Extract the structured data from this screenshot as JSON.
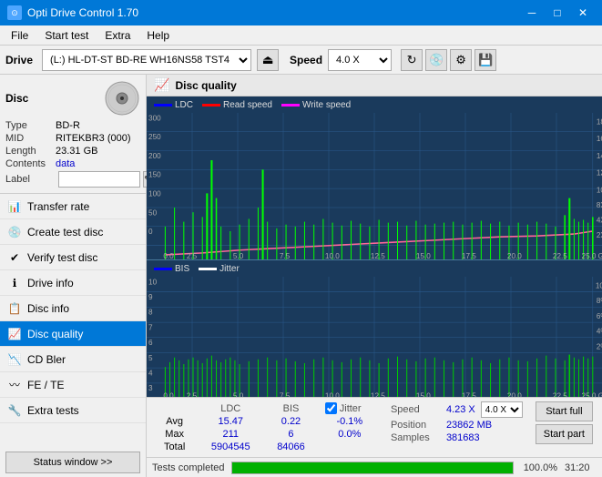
{
  "titleBar": {
    "title": "Opti Drive Control 1.70",
    "minBtn": "─",
    "maxBtn": "□",
    "closeBtn": "✕"
  },
  "menuBar": {
    "items": [
      "File",
      "Start test",
      "Extra",
      "Help"
    ]
  },
  "driveBar": {
    "driveLabel": "Drive",
    "driveValue": "(L:)  HL-DT-ST BD-RE  WH16NS58 TST4",
    "speedLabel": "Speed",
    "speedValue": "4.0 X"
  },
  "disc": {
    "title": "Disc",
    "typeLabel": "Type",
    "typeValue": "BD-R",
    "midLabel": "MID",
    "midValue": "RITEKBR3 (000)",
    "lengthLabel": "Length",
    "lengthValue": "23.31 GB",
    "contentsLabel": "Contents",
    "contentsValue": "data",
    "labelLabel": "Label",
    "labelValue": ""
  },
  "navItems": [
    {
      "id": "transfer-rate",
      "label": "Transfer rate",
      "icon": "📊"
    },
    {
      "id": "create-test-disc",
      "label": "Create test disc",
      "icon": "💿"
    },
    {
      "id": "verify-test-disc",
      "label": "Verify test disc",
      "icon": "✔"
    },
    {
      "id": "drive-info",
      "label": "Drive info",
      "icon": "ℹ"
    },
    {
      "id": "disc-info",
      "label": "Disc info",
      "icon": "📋"
    },
    {
      "id": "disc-quality",
      "label": "Disc quality",
      "icon": "📈",
      "active": true
    },
    {
      "id": "cd-bler",
      "label": "CD Bler",
      "icon": "📉"
    },
    {
      "id": "fe-te",
      "label": "FE / TE",
      "icon": "〰"
    },
    {
      "id": "extra-tests",
      "label": "Extra tests",
      "icon": "🔧"
    }
  ],
  "statusBtn": "Status window >>",
  "panel": {
    "title": "Disc quality",
    "legend1": {
      "color": "#0000ff",
      "label": "LDC"
    },
    "legend2": {
      "color": "#ff0000",
      "label": "Read speed"
    },
    "legend3": {
      "color": "#ff00ff",
      "label": "Write speed"
    },
    "legend4": {
      "color": "#0000ff",
      "label": "BIS"
    },
    "legend5": {
      "color": "#00ff00",
      "label": "Jitter"
    }
  },
  "stats": {
    "columns": [
      "",
      "LDC",
      "BIS"
    ],
    "rows": [
      {
        "label": "Avg",
        "ldc": "15.47",
        "bis": "0.22",
        "jitterVal": "-0.1%"
      },
      {
        "label": "Max",
        "ldc": "211",
        "bis": "6",
        "jitterVal": "0.0%"
      },
      {
        "label": "Total",
        "ldc": "5904545",
        "bis": "84066",
        "jitterVal": ""
      }
    ],
    "jitterLabel": "Jitter",
    "jitterChecked": true,
    "speedLabel": "Speed",
    "speedValue": "4.23 X",
    "speedSelect": "4.0 X",
    "positionLabel": "Position",
    "positionValue": "23862 MB",
    "samplesLabel": "Samples",
    "samplesValue": "381683"
  },
  "buttons": {
    "startFull": "Start full",
    "startPart": "Start part"
  },
  "progressBar": {
    "label": "Tests completed",
    "percent": 100,
    "percentText": "100.0%",
    "time": "31:20"
  }
}
